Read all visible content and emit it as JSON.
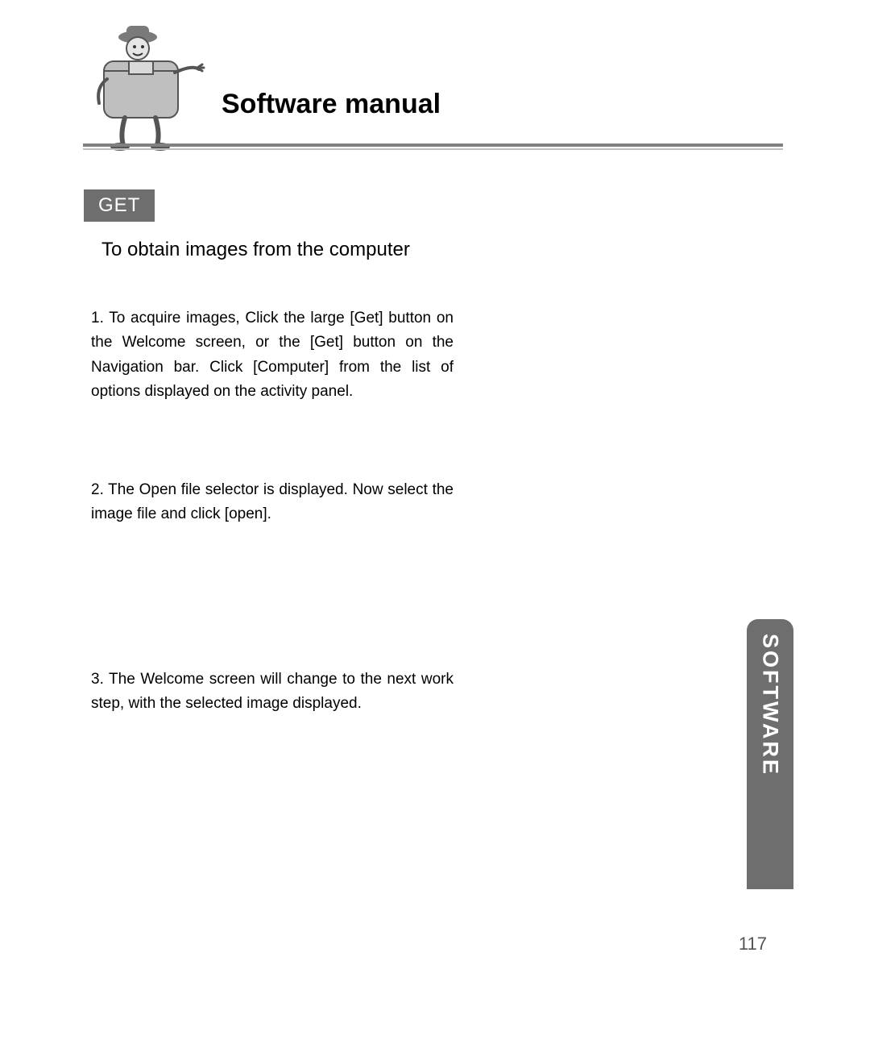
{
  "header": {
    "title": "Software manual"
  },
  "label": {
    "get": "GET"
  },
  "subheading": "To obtain images from the computer",
  "steps": {
    "s1": "1. To acquire images, Click the large [Get] button on the Welcome screen, or the [Get] button on the Navigation bar. Click [Computer] from the list of options displayed on the activity panel.",
    "s2": "2. The Open file selector is displayed. Now select the image file and click [open].",
    "s3": "3. The Welcome screen will change to the next work step, with the selected image displayed."
  },
  "sidetab": "SOFTWARE",
  "page_number": "117"
}
